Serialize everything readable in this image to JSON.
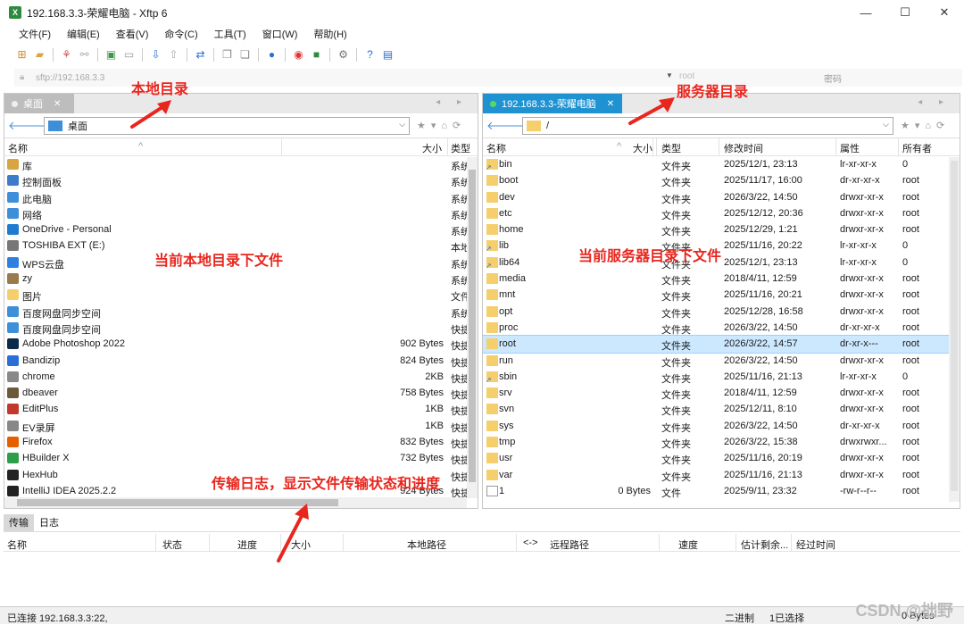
{
  "window": {
    "title": "192.168.3.3-荣耀电脑 - Xftp 6",
    "app_icon": "xftp-icon"
  },
  "menu": [
    "文件(F)",
    "编辑(E)",
    "查看(V)",
    "命令(C)",
    "工具(T)",
    "窗口(W)",
    "帮助(H)"
  ],
  "address": {
    "host_placeholder": "sftp://192.168.3.3",
    "user_placeholder": "root",
    "password_placeholder": "密码"
  },
  "local": {
    "tab_label": "桌面",
    "path": "桌面",
    "columns": [
      "名称",
      "大小",
      "类型"
    ],
    "files": [
      {
        "name": "库",
        "size": "",
        "type": "系统",
        "icon": "library-icon",
        "color": "#d9a441"
      },
      {
        "name": "控制面板",
        "size": "",
        "type": "系统",
        "icon": "control-panel-icon",
        "color": "#3d7cc9"
      },
      {
        "name": "此电脑",
        "size": "",
        "type": "系统",
        "icon": "computer-icon",
        "color": "#3d8fd9"
      },
      {
        "name": "网络",
        "size": "",
        "type": "系统",
        "icon": "network-icon",
        "color": "#3d8fd9"
      },
      {
        "name": "OneDrive - Personal",
        "size": "",
        "type": "系统",
        "icon": "onedrive-icon",
        "color": "#1f7ad1"
      },
      {
        "name": "TOSHIBA EXT (E:)",
        "size": "",
        "type": "本地",
        "icon": "drive-icon",
        "color": "#777777"
      },
      {
        "name": "WPS云盘",
        "size": "",
        "type": "系统",
        "icon": "cloud-icon",
        "color": "#2f7fe0"
      },
      {
        "name": "zy",
        "size": "",
        "type": "系统",
        "icon": "user-icon",
        "color": "#9a7a4a"
      },
      {
        "name": "图片",
        "size": "",
        "type": "文件",
        "icon": "folder-icon",
        "color": "#f5cf6b"
      },
      {
        "name": "百度网盘同步空间",
        "size": "",
        "type": "系统",
        "icon": "sync-folder-icon",
        "color": "#3d8fd9"
      },
      {
        "name": "百度网盘同步空间",
        "size": "",
        "type": "快捷",
        "icon": "sync-folder-icon",
        "color": "#3d8fd9"
      },
      {
        "name": "Adobe Photoshop 2022",
        "size": "902 Bytes",
        "type": "快捷",
        "icon": "photoshop-icon",
        "color": "#0b2a4a"
      },
      {
        "name": "Bandizip",
        "size": "824 Bytes",
        "type": "快捷",
        "icon": "bandizip-icon",
        "color": "#2a6fd6"
      },
      {
        "name": "chrome",
        "size": "2KB",
        "type": "快捷",
        "icon": "shortcut-icon",
        "color": "#888888"
      },
      {
        "name": "dbeaver",
        "size": "758 Bytes",
        "type": "快捷",
        "icon": "dbeaver-icon",
        "color": "#6b5a3a"
      },
      {
        "name": "EditPlus",
        "size": "1KB",
        "type": "快捷",
        "icon": "editplus-icon",
        "color": "#c0392b"
      },
      {
        "name": "EV录屏",
        "size": "1KB",
        "type": "快捷",
        "icon": "ev-icon",
        "color": "#888888"
      },
      {
        "name": "Firefox",
        "size": "832 Bytes",
        "type": "快捷",
        "icon": "firefox-icon",
        "color": "#e66000"
      },
      {
        "name": "HBuilder X",
        "size": "732 Bytes",
        "type": "快捷",
        "icon": "hbuilder-icon",
        "color": "#2e9e48"
      },
      {
        "name": "HexHub",
        "size": "",
        "type": "快捷",
        "icon": "hexhub-icon",
        "color": "#222222"
      },
      {
        "name": "IntelliJ IDEA 2025.2.2",
        "size": "924 Bytes",
        "type": "快捷",
        "icon": "idea-icon",
        "color": "#222222"
      }
    ]
  },
  "remote": {
    "tab_label": "192.168.3.3-荣耀电脑",
    "path": "/",
    "columns": [
      "名称",
      "大小",
      "类型",
      "修改时间",
      "属性",
      "所有者"
    ],
    "files": [
      {
        "name": "bin",
        "size": "",
        "type": "文件夹",
        "mtime": "2025/12/1, 23:13",
        "attr": "lr-xr-xr-x",
        "owner": "0",
        "link": true
      },
      {
        "name": "boot",
        "size": "",
        "type": "文件夹",
        "mtime": "2025/11/17, 16:00",
        "attr": "dr-xr-xr-x",
        "owner": "root"
      },
      {
        "name": "dev",
        "size": "",
        "type": "文件夹",
        "mtime": "2026/3/22, 14:50",
        "attr": "drwxr-xr-x",
        "owner": "root"
      },
      {
        "name": "etc",
        "size": "",
        "type": "文件夹",
        "mtime": "2025/12/12, 20:36",
        "attr": "drwxr-xr-x",
        "owner": "root"
      },
      {
        "name": "home",
        "size": "",
        "type": "文件夹",
        "mtime": "2025/12/29, 1:21",
        "attr": "drwxr-xr-x",
        "owner": "root"
      },
      {
        "name": "lib",
        "size": "",
        "type": "文件夹",
        "mtime": "2025/11/16, 20:22",
        "attr": "lr-xr-xr-x",
        "owner": "0",
        "link": true
      },
      {
        "name": "lib64",
        "size": "",
        "type": "文件夹",
        "mtime": "2025/12/1, 23:13",
        "attr": "lr-xr-xr-x",
        "owner": "0",
        "link": true
      },
      {
        "name": "media",
        "size": "",
        "type": "文件夹",
        "mtime": "2018/4/11, 12:59",
        "attr": "drwxr-xr-x",
        "owner": "root"
      },
      {
        "name": "mnt",
        "size": "",
        "type": "文件夹",
        "mtime": "2025/11/16, 20:21",
        "attr": "drwxr-xr-x",
        "owner": "root"
      },
      {
        "name": "opt",
        "size": "",
        "type": "文件夹",
        "mtime": "2025/12/28, 16:58",
        "attr": "drwxr-xr-x",
        "owner": "root"
      },
      {
        "name": "proc",
        "size": "",
        "type": "文件夹",
        "mtime": "2026/3/22, 14:50",
        "attr": "dr-xr-xr-x",
        "owner": "root"
      },
      {
        "name": "root",
        "size": "",
        "type": "文件夹",
        "mtime": "2026/3/22, 14:57",
        "attr": "dr-xr-x---",
        "owner": "root",
        "selected": true
      },
      {
        "name": "run",
        "size": "",
        "type": "文件夹",
        "mtime": "2026/3/22, 14:50",
        "attr": "drwxr-xr-x",
        "owner": "root"
      },
      {
        "name": "sbin",
        "size": "",
        "type": "文件夹",
        "mtime": "2025/11/16, 21:13",
        "attr": "lr-xr-xr-x",
        "owner": "0",
        "link": true
      },
      {
        "name": "srv",
        "size": "",
        "type": "文件夹",
        "mtime": "2018/4/11, 12:59",
        "attr": "drwxr-xr-x",
        "owner": "root"
      },
      {
        "name": "svn",
        "size": "",
        "type": "文件夹",
        "mtime": "2025/12/11, 8:10",
        "attr": "drwxr-xr-x",
        "owner": "root"
      },
      {
        "name": "sys",
        "size": "",
        "type": "文件夹",
        "mtime": "2026/3/22, 14:50",
        "attr": "dr-xr-xr-x",
        "owner": "root"
      },
      {
        "name": "tmp",
        "size": "",
        "type": "文件夹",
        "mtime": "2026/3/22, 15:38",
        "attr": "drwxrwxr...",
        "owner": "root"
      },
      {
        "name": "usr",
        "size": "",
        "type": "文件夹",
        "mtime": "2025/11/16, 20:19",
        "attr": "drwxr-xr-x",
        "owner": "root"
      },
      {
        "name": "var",
        "size": "",
        "type": "文件夹",
        "mtime": "2025/11/16, 21:13",
        "attr": "drwxr-xr-x",
        "owner": "root"
      },
      {
        "name": "1",
        "size": "0 Bytes",
        "type": "文件",
        "mtime": "2025/9/11, 23:32",
        "attr": "-rw-r--r--",
        "owner": "root",
        "file": true
      }
    ]
  },
  "bottom": {
    "tabs": [
      "传输",
      "日志"
    ],
    "columns": [
      "名称",
      "状态",
      "进度",
      "大小",
      "本地路径",
      "<->",
      "远程路径",
      "速度",
      "估计剩余...",
      "经过时间"
    ]
  },
  "status": {
    "connection": "已连接 192.168.3.3:22,",
    "mode": "二进制",
    "selection": "1已选择",
    "bytes": "0 Bytes"
  },
  "annotations": {
    "local_dir": "本地目录",
    "server_dir": "服务器目录",
    "local_files": "当前本地目录下文件",
    "server_files": "当前服务器目录下文件",
    "log": "传输日志，显示文件传输状态和进度"
  },
  "watermark": "CSDN @拙野",
  "colors": {
    "accent": "#1f93d2",
    "annotation": "#e8261e",
    "folder": "#f5cf6b"
  }
}
